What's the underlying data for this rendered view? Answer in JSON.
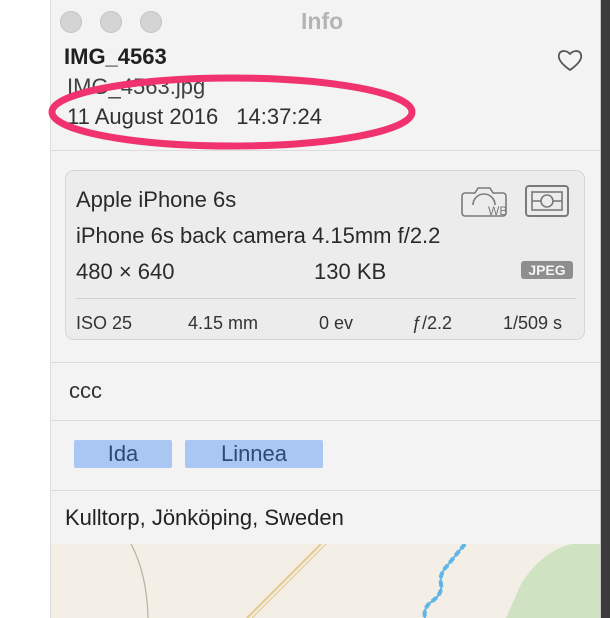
{
  "window": {
    "title": "Info"
  },
  "photo": {
    "title": "IMG_4563",
    "filename": "IMG_4563.jpg",
    "date": "11 August 2016",
    "time": "14:37:24"
  },
  "icons": {
    "favorite": "heart-icon",
    "white_balance": "camera-wb-icon",
    "metering": "metering-icon"
  },
  "exif": {
    "device": "Apple iPhone 6s",
    "lens": "iPhone 6s back camera 4.15mm f/2.2",
    "dimensions": "480 × 640",
    "file_size": "130 KB",
    "format_badge": "JPEG",
    "iso": "ISO 25",
    "focal_length": "4.15 mm",
    "exposure_bias": "0 ev",
    "aperture": "ƒ/2.2",
    "shutter": "1/509 s"
  },
  "caption": "ccc",
  "people": [
    "Ida",
    "Linnea"
  ],
  "location": "Kulltorp, Jönköping, Sweden",
  "colors": {
    "annotation": "#f0336e",
    "tag_bg": "#a9c7f2",
    "panel_bg": "#f3f3f3",
    "map_water": "#5fb6e6",
    "map_green": "#cfe3c2"
  }
}
